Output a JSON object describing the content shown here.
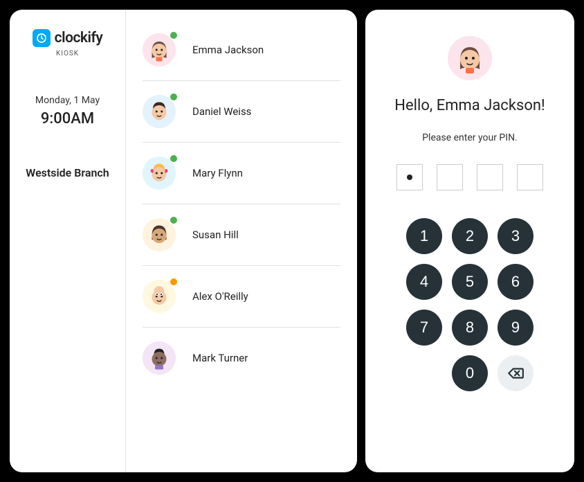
{
  "brand": {
    "name": "clockify",
    "kiosk": "KIOSK"
  },
  "sidebar": {
    "date": "Monday, 1 May",
    "time": "9:00AM",
    "branch": "Westside Branch"
  },
  "users": [
    {
      "name": "Emma Jackson",
      "status": "green",
      "avatar_bg": "#fce4ec"
    },
    {
      "name": "Daniel Weiss",
      "status": "green",
      "avatar_bg": "#e3f2fd"
    },
    {
      "name": "Mary Flynn",
      "status": "green",
      "avatar_bg": "#e1f5fe"
    },
    {
      "name": "Susan Hill",
      "status": "green",
      "avatar_bg": "#fff3e0"
    },
    {
      "name": "Alex O'Reilly",
      "status": "orange",
      "avatar_bg": "#fff8e1"
    },
    {
      "name": "Mark Turner",
      "status": "none",
      "avatar_bg": "#f3e5f5"
    }
  ],
  "pin_screen": {
    "greeting": "Hello, Emma Jackson!",
    "prompt": "Please enter your PIN.",
    "selected_avatar_bg": "#fce4ec",
    "pin_entered": 1,
    "pin_length": 4
  },
  "keypad": {
    "keys": [
      "1",
      "2",
      "3",
      "4",
      "5",
      "6",
      "7",
      "8",
      "9",
      "",
      "0",
      "backspace"
    ]
  }
}
